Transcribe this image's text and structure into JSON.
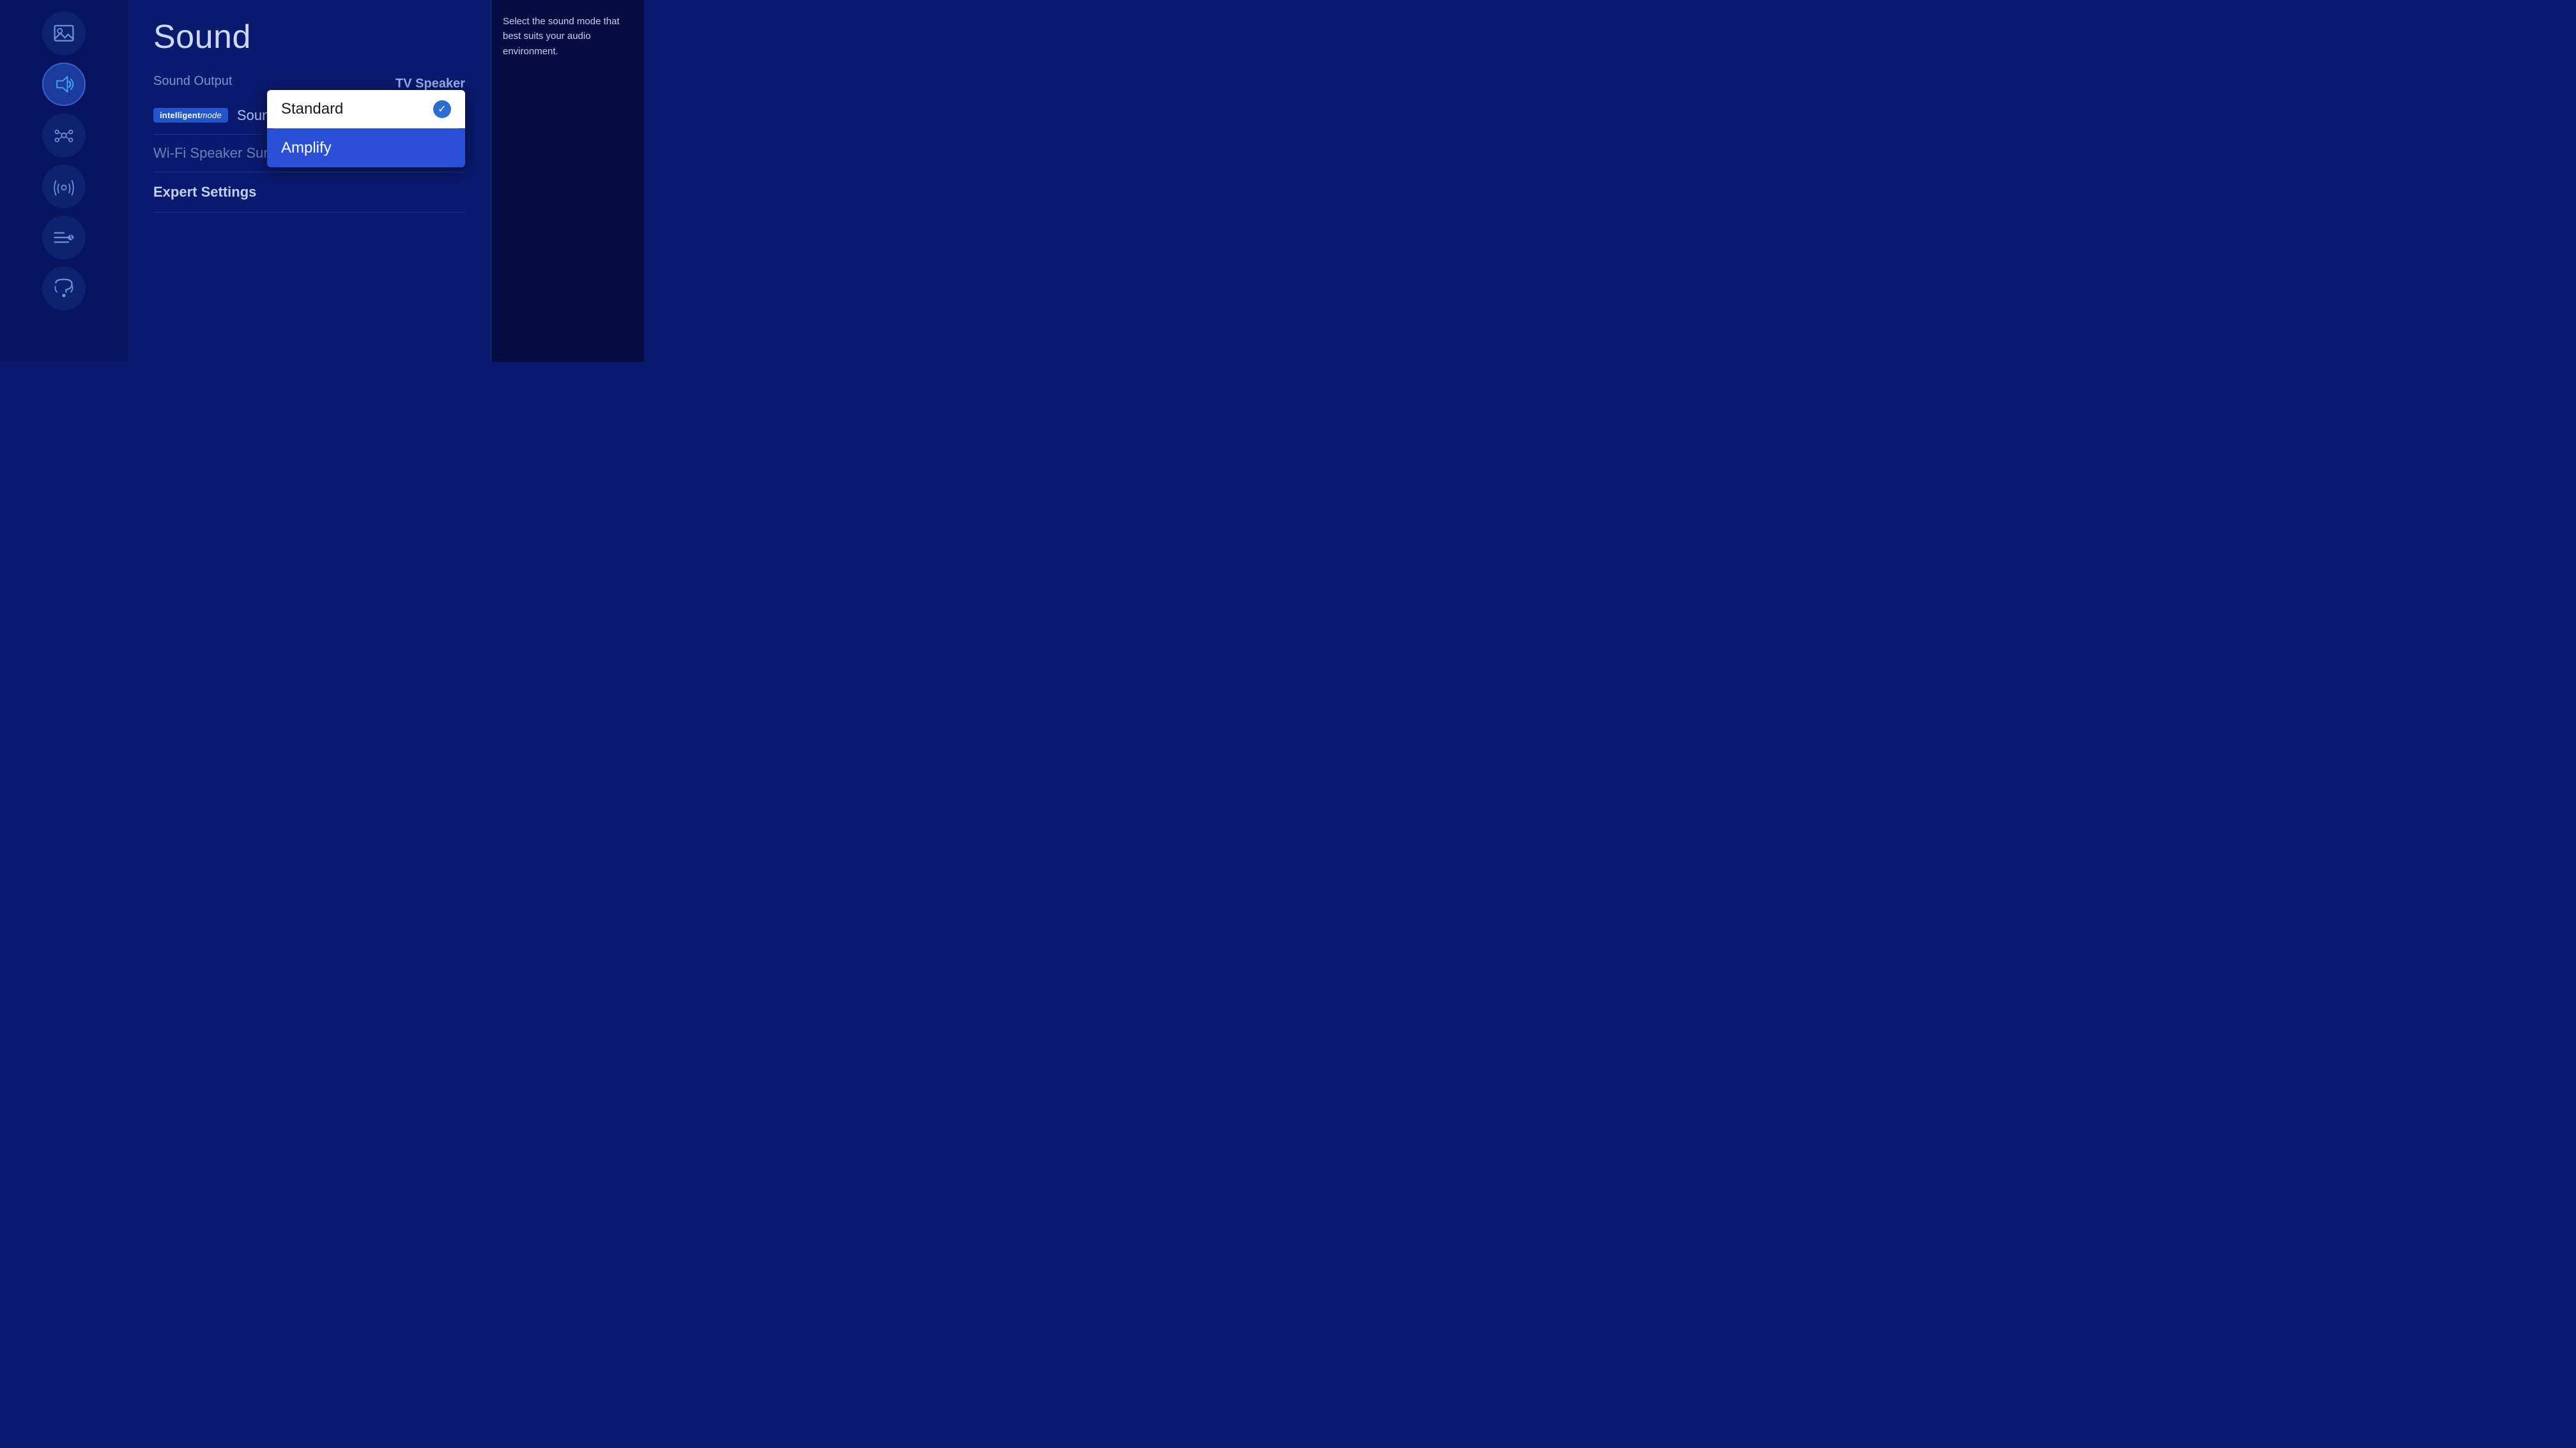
{
  "page": {
    "title": "Sound"
  },
  "sidebar": {
    "items": [
      {
        "id": "picture",
        "label": "Picture",
        "active": false
      },
      {
        "id": "sound",
        "label": "Sound",
        "active": true
      },
      {
        "id": "network",
        "label": "Network",
        "active": false
      },
      {
        "id": "broadcast",
        "label": "Broadcast",
        "active": false
      },
      {
        "id": "accessibility",
        "label": "Accessibility",
        "active": false
      },
      {
        "id": "support",
        "label": "Support",
        "active": false
      }
    ]
  },
  "main": {
    "sound_output": {
      "section_label": "Sound Output",
      "tv_speaker_label": "TV Speaker",
      "sound_mode": {
        "badge_text": "intelligent",
        "badge_mode": "mode",
        "label": "Sound Mode"
      },
      "wifi_surround": {
        "label": "Wi-Fi Speaker Surround Se..."
      }
    },
    "dropdown": {
      "options": [
        {
          "label": "Standard",
          "selected": true
        },
        {
          "label": "Amplify",
          "highlighted": true
        }
      ]
    },
    "expert_settings": {
      "label": "Expert Settings"
    }
  },
  "right_panel": {
    "help_text": "Select the sound mode that best suits your audio environment."
  }
}
